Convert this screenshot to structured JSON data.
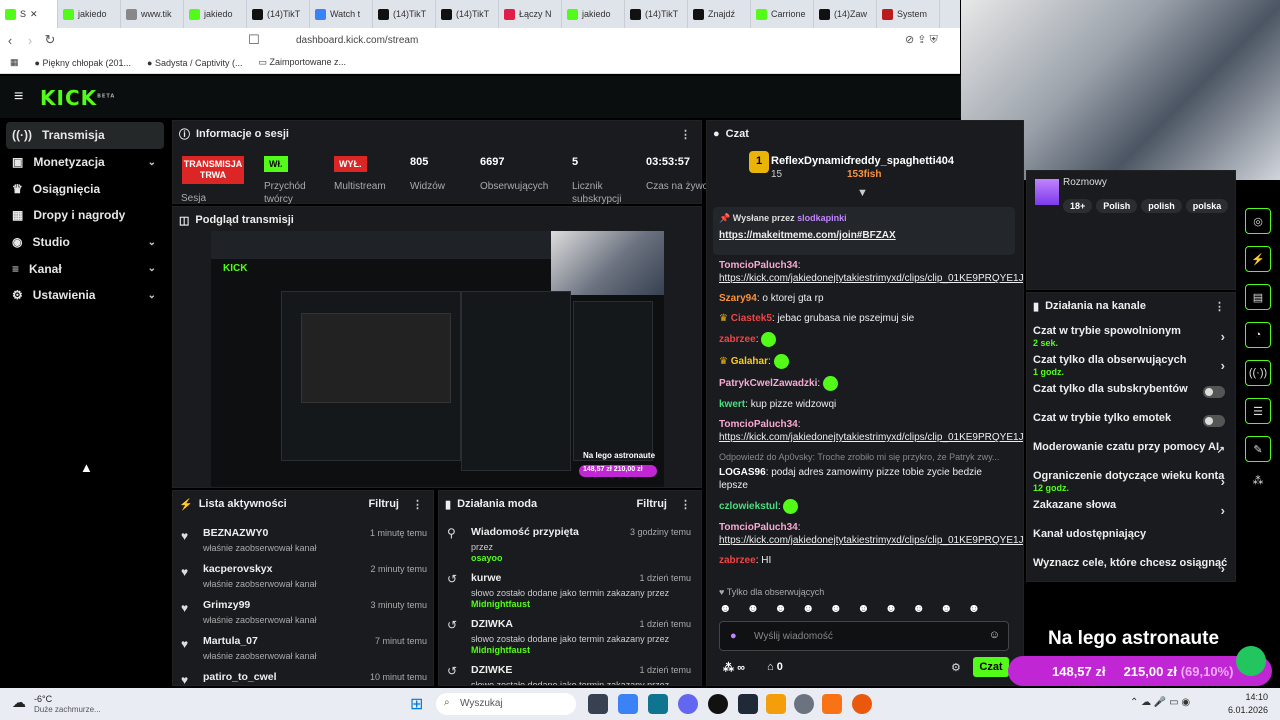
{
  "browser": {
    "tabs": [
      {
        "title": "S",
        "color": "#53fc18"
      },
      {
        "title": "jakiedo",
        "color": "#53fc18"
      },
      {
        "title": "www.tik",
        "color": "#888888"
      },
      {
        "title": "jakiedo",
        "color": "#53fc18"
      },
      {
        "title": "(14)TikT",
        "color": "#111111"
      },
      {
        "title": "Watch t",
        "color": "#3b82f6"
      },
      {
        "title": "(14)TikT",
        "color": "#111111"
      },
      {
        "title": "(14)TikT",
        "color": "#111111"
      },
      {
        "title": "Łączy N",
        "color": "#e11d48"
      },
      {
        "title": "jakiedo",
        "color": "#53fc18"
      },
      {
        "title": "(14)TikT",
        "color": "#111111"
      },
      {
        "title": "Znajdź",
        "color": "#111111"
      },
      {
        "title": "Carrione",
        "color": "#53fc18"
      },
      {
        "title": "(14)Zaw",
        "color": "#111111"
      },
      {
        "title": "System",
        "color": "#b91c1c"
      }
    ],
    "url": "dashboard.kick.com/stream",
    "bookmarks": [
      "Piękny chłopak (201...",
      "Sadysta / Captivity (...",
      "Zaimportowane z..."
    ]
  },
  "kick": {
    "logo": "KICK",
    "beta": "BETA"
  },
  "sidebar": {
    "items": [
      {
        "label": "Transmisja",
        "icon": "broadcast-icon",
        "chev": false
      },
      {
        "label": "Monetyzacja",
        "icon": "money-icon",
        "chev": true
      },
      {
        "label": "Osiągnięcia",
        "icon": "trophy-icon",
        "chev": false
      },
      {
        "label": "Dropy i nagrody",
        "icon": "gift-icon",
        "chev": false
      },
      {
        "label": "Studio",
        "icon": "studio-icon",
        "chev": true
      },
      {
        "label": "Kanał",
        "icon": "channel-icon",
        "chev": true
      },
      {
        "label": "Ustawienia",
        "icon": "gear-icon",
        "chev": true
      }
    ]
  },
  "session": {
    "title": "Informacje o sesji",
    "status": "TRANSMISJA TRWA",
    "status_label": "Sesja",
    "stats": [
      {
        "value": "Wł.",
        "label": "Przychód twórcy",
        "badge": "green"
      },
      {
        "value": "WYŁ.",
        "label": "Multistream",
        "badge": "red"
      },
      {
        "value": "805",
        "label": "Widzów"
      },
      {
        "value": "6697",
        "label": "Obserwujących"
      },
      {
        "value": "5",
        "label": "Licznik subskrypcji"
      },
      {
        "value": "03:53:57",
        "label": "Czas na żywo"
      }
    ]
  },
  "preview": {
    "title": "Podgląd transmisji",
    "overlay": "Na lego astronaute",
    "amount1": "148,57 zł",
    "amount2": "210,00 zł"
  },
  "activity": {
    "title": "Lista aktywności",
    "filter": "Filtruj",
    "rows": [
      {
        "name": "BEZNAZWY0",
        "desc": "właśnie zaobserwował kanał",
        "time": "1 minutę temu"
      },
      {
        "name": "kacperovskyx",
        "desc": "właśnie zaobserwował kanał",
        "time": "2 minuty temu"
      },
      {
        "name": "Grimzy99",
        "desc": "właśnie zaobserwował kanał",
        "time": "3 minuty temu"
      },
      {
        "name": "Martula_07",
        "desc": "właśnie zaobserwował kanał",
        "time": "7 minut temu"
      },
      {
        "name": "patiro_to_cwel",
        "desc": "",
        "time": "10 minut temu"
      }
    ]
  },
  "mod": {
    "title": "Działania moda",
    "filter": "Filtruj",
    "rows": [
      {
        "name": "Wiadomość przypięta",
        "desc": "przez ",
        "who": "osayoo",
        "time": "3 godziny temu",
        "icon": "pin-icon"
      },
      {
        "name": "kurwe",
        "desc": "słowo zostało dodane jako termin zakazany przez",
        "who": "Midnightfaust",
        "time": "1 dzień temu",
        "icon": "undo-icon"
      },
      {
        "name": "DZIWKA",
        "desc": "słowo zostało dodane jako termin zakazany przez",
        "who": "Midnightfaust",
        "time": "1 dzień temu",
        "icon": "undo-icon"
      },
      {
        "name": "DZIWKE",
        "desc": "słowo zostało dodane jako termin zakazany przez",
        "who": "",
        "time": "1 dzień temu",
        "icon": "undo-icon"
      }
    ]
  },
  "chat": {
    "title": "Czat",
    "gifter": {
      "rank": "1",
      "name": "ReflexDynamic",
      "count": "15",
      "name2": "freddy_spaghetti404",
      "amount": "153fish"
    },
    "pinned": {
      "label": "Wysłane przez",
      "by": "slodkapinki",
      "link": "https://makeitmeme.com/join#BFZAX"
    },
    "messages": [
      {
        "user": "TomcioPaluch34",
        "color": "#f9a8d4",
        "text": "https://kick.com/jakiedonejtytakiestrimyxd/clips/clip_01KE9PRQYE1JFQ5XEZCFQ68B76",
        "link": true
      },
      {
        "user": "Szary94",
        "color": "#fb923c",
        "text": "o ktorej gta rp"
      },
      {
        "user": "Ciastek5",
        "color": "#ef4444",
        "text": "jebac grubasa nie pszejmuj sie",
        "badge": true
      },
      {
        "user": "zabrzee",
        "color": "#ef4444",
        "text": "",
        "emote": true
      },
      {
        "user": "Galahar",
        "color": "#facc15",
        "text": "",
        "emote": true,
        "badge": true
      },
      {
        "user": "PatrykCwelZawadzki",
        "color": "#f9a8d4",
        "text": "",
        "emote": true
      },
      {
        "user": "kwert",
        "color": "#4ade80",
        "text": "kup pizze widzowqi"
      },
      {
        "user": "TomcioPaluch34",
        "color": "#f9a8d4",
        "text": "https://kick.com/jakiedonejtytakiestrimyxd/clips/clip_01KE9PRQYE1JFQ5XEZCFQ68B76",
        "link": true
      },
      {
        "user": "LOGAS96",
        "color": "#fff",
        "text": "podaj adres zamowimy pizze tobie zycie bedzie lepsze",
        "reply": "Odpowiedź do Ap0vsky: Troche zrobiło mi się przykro, że Patryk zwy..."
      },
      {
        "user": "czlowiekstul",
        "color": "#4ade80",
        "text": "",
        "emote": true
      },
      {
        "user": "TomcioPaluch34",
        "color": "#f9a8d4",
        "text": "https://kick.com/jakiedonejtytakiestrimyxd/clips/clip_01KE9PRQYE1JFQ5XEZCFQ68B76",
        "link": true
      },
      {
        "user": "zabrzee",
        "color": "#ef4444",
        "text": "HI"
      }
    ],
    "followers_only": "Tylko dla obserwujących",
    "placeholder": "Wyślij wiadomość",
    "send": "Czat",
    "points": "∞",
    "count": "0"
  },
  "tags": {
    "category": "Rozmowy",
    "chips": [
      "18+",
      "Polish",
      "polish",
      "polska"
    ]
  },
  "channel": {
    "title": "Działania na kanale",
    "rows": [
      {
        "label": "Czat w trybie spowolnionym",
        "sub": "2 sek.",
        "kind": "arrow"
      },
      {
        "label": "Czat tylko dla obserwujących",
        "sub": "1 godz.",
        "kind": "arrow"
      },
      {
        "label": "Czat tylko dla subskrybentów",
        "sub": "",
        "kind": "toggle"
      },
      {
        "label": "Czat w trybie tylko emotek",
        "sub": "",
        "kind": "toggle"
      },
      {
        "label": "Moderowanie czatu przy pomocy AI",
        "sub": "",
        "kind": "ext"
      },
      {
        "label": "Ograniczenie dotyczące wieku konta",
        "sub": "12 godz.",
        "kind": "arrow"
      },
      {
        "label": "Zakazane słowa",
        "sub": "",
        "kind": "arrow"
      },
      {
        "label": "Kanał udostępniający",
        "sub": "",
        "kind": "none"
      },
      {
        "label": "Wyznacz cele, które chcesz osiągnąć",
        "sub": "",
        "kind": "arrow"
      }
    ]
  },
  "overlay": {
    "title": "Na lego astronaute",
    "amount1": "148,57 zł",
    "amount2": "215,00 zł",
    "pct": "(69,10%)"
  },
  "taskbar": {
    "temp": "-6°C",
    "weather": "Duże zachmurze...",
    "search": "Wyszukaj",
    "time": "14:10",
    "date": "6.01.2026"
  }
}
